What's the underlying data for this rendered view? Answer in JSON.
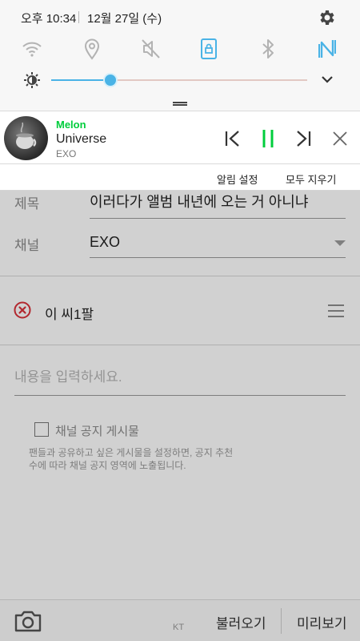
{
  "status_bar": {
    "time": "오후 10:34",
    "date": "12월 27일 (수)"
  },
  "quick_settings": [
    {
      "name": "wifi",
      "active": false
    },
    {
      "name": "location",
      "active": false
    },
    {
      "name": "sound-mute",
      "active": false
    },
    {
      "name": "screen-rotation-lock",
      "active": true
    },
    {
      "name": "bluetooth",
      "active": false
    },
    {
      "name": "nfc",
      "active": true
    }
  ],
  "brightness": {
    "level": 0.23
  },
  "colors": {
    "accent_blue": "#4ab3e6",
    "melon_green": "#00cd3c",
    "qs_inactive": "#b3b3b3",
    "error_red": "#d9313a"
  },
  "music": {
    "app_name": "Melon",
    "title": "Universe",
    "artist": "EXO",
    "state": "playing"
  },
  "notification_actions": {
    "settings": "알림 설정",
    "clear_all": "모두 지우기"
  },
  "post_form": {
    "title_label": "제목",
    "title_value": "이러다가 앨범 내년에 오는 거 아니냐",
    "channel_label": "채널",
    "channel_value": "EXO",
    "attachment_name": "이 씨1팔",
    "content_placeholder": "내용을 입력하세요.",
    "notice_checkbox_label": "채널 공지 게시물",
    "notice_help": "팬들과 공유하고 싶은 게시물을 설정하면, 공지 추천수에 따라 채널 공지 영역에 노출됩니다.",
    "notice_checked": false
  },
  "bottom_bar": {
    "carrier": "KT",
    "load_label": "불러오기",
    "preview_label": "미리보기"
  }
}
